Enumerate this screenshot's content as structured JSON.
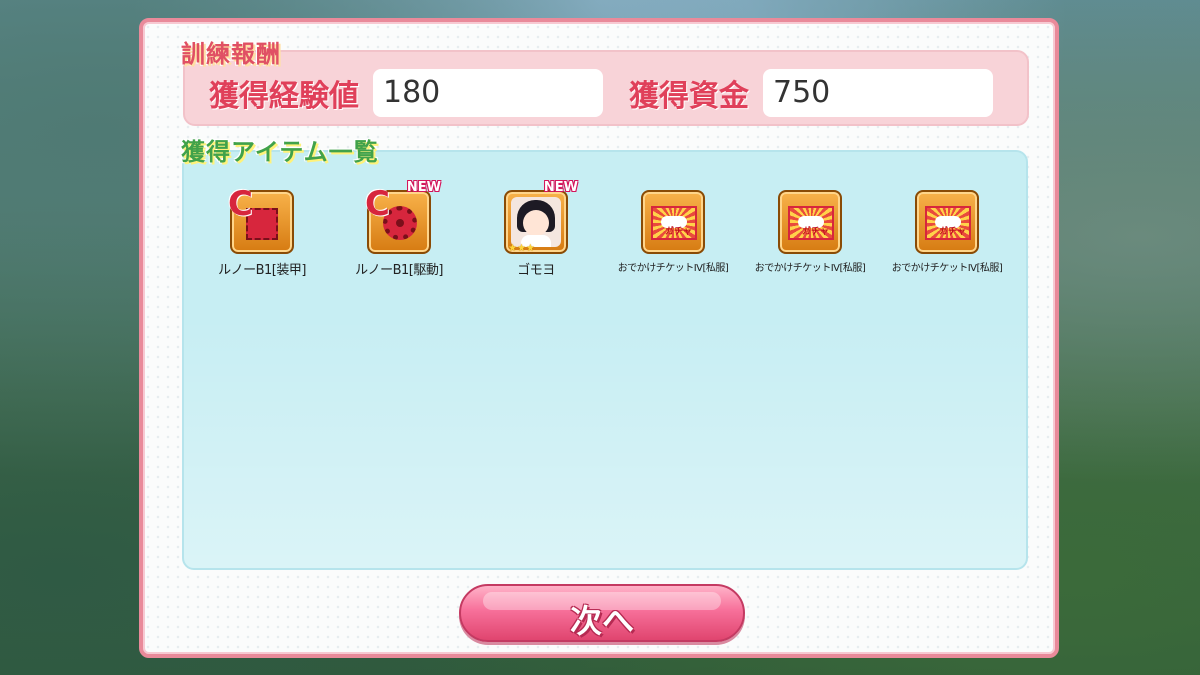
{
  "reward": {
    "title": "訓練報酬",
    "exp_label": "獲得経験値",
    "exp_value": "180",
    "funds_label": "獲得資金",
    "funds_value": "750"
  },
  "items_section": {
    "title": "獲得アイテム一覧",
    "items": [
      {
        "name": "ルノーB1[装甲]",
        "icon": "armor-part-icon",
        "new": ""
      },
      {
        "name": "ルノーB1[駆動]",
        "icon": "drive-gear-part-icon",
        "new": "NEW"
      },
      {
        "name": "ゴモヨ",
        "icon": "character-portrait-icon",
        "new": "NEW"
      },
      {
        "name": "おでかけチケットIV[私服]",
        "icon": "gacha-ticket-icon",
        "new": ""
      },
      {
        "name": "おでかけチケットIV[私服]",
        "icon": "gacha-ticket-icon",
        "new": ""
      },
      {
        "name": "おでかけチケットIV[私服]",
        "icon": "gacha-ticket-icon",
        "new": ""
      }
    ],
    "part_mark": "C",
    "ticket_mark": "ガチャ",
    "stars": "★★★"
  },
  "button": {
    "next_label": "次へ"
  },
  "colors": {
    "panel_border": "#e98a9a",
    "reward_bg": "#f8d3d8",
    "items_bg": "#c7eef3",
    "accent_red": "#e0405a",
    "accent_green": "#41a24a",
    "button_pink": "#f7709a"
  }
}
